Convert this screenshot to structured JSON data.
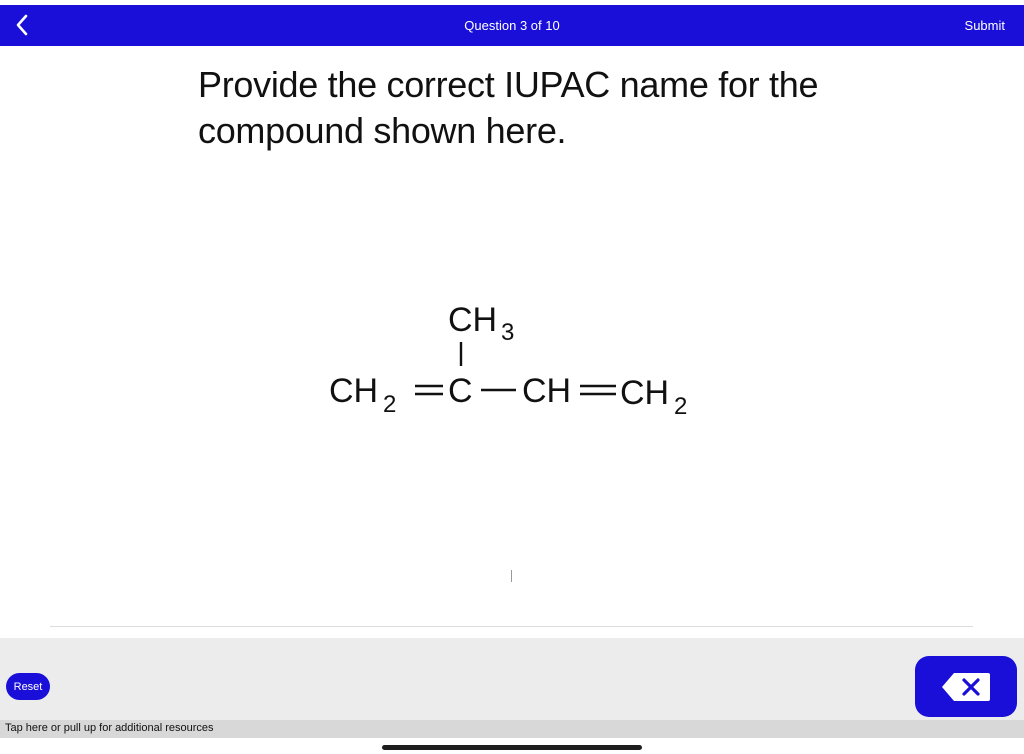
{
  "header": {
    "title": "Question 3 of 10",
    "submit_label": "Submit",
    "back_icon": "chevron-left-icon",
    "bar_color": "#1a0fd8"
  },
  "question": {
    "prompt": "Provide the correct IUPAC name for the compound shown here."
  },
  "structure": {
    "top_group": "CH",
    "top_group_subscript": "3",
    "left_group": "CH",
    "left_group_subscript": "2",
    "center_atom": "C",
    "right_ch": "CH",
    "right_group": "CH",
    "right_group_subscript": "2"
  },
  "controls": {
    "reset_label": "Reset",
    "delete_icon": "backspace-icon"
  },
  "footer": {
    "resources_text": "Tap here or pull up for additional resources"
  }
}
